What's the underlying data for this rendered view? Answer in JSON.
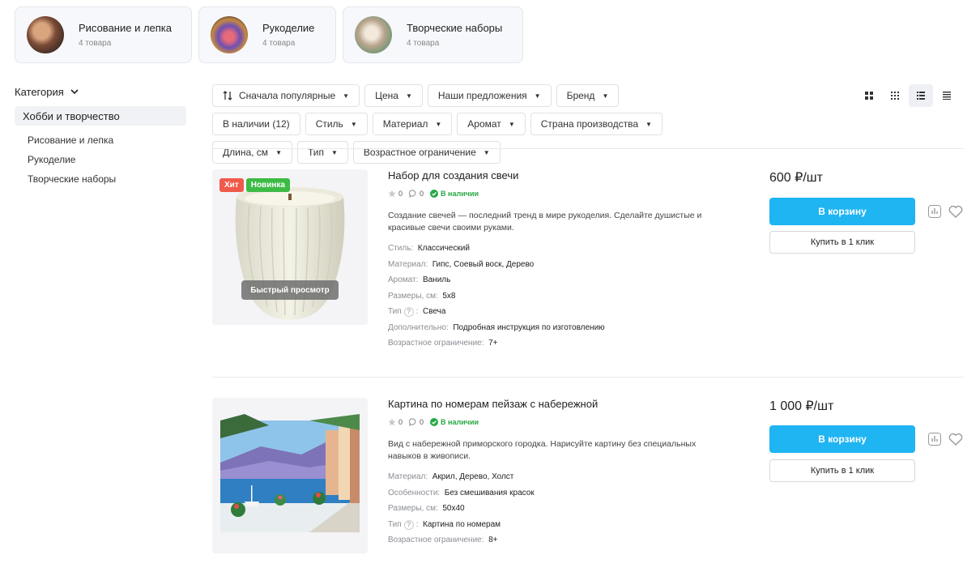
{
  "top_categories": [
    {
      "name": "Рисование и лепка",
      "count": "4 товара"
    },
    {
      "name": "Рукоделие",
      "count": "4 товара"
    },
    {
      "name": "Творческие наборы",
      "count": "4 товара"
    }
  ],
  "sidebar": {
    "heading": "Категория",
    "active": "Хобби и творчество",
    "items": [
      "Рисование и лепка",
      "Рукоделие",
      "Творческие наборы"
    ]
  },
  "filters": [
    "Сначала популярные",
    "Цена",
    "Наши предложения",
    "Бренд",
    "В наличии (12)",
    "Стиль",
    "Материал",
    "Аромат",
    "Страна производства",
    "Длина, см",
    "Тип",
    "Возрастное ограничение"
  ],
  "products": [
    {
      "title": "Набор для создания свечи",
      "rating": "0",
      "reviews": "0",
      "stock": "В наличии",
      "badges": [
        "Хит",
        "Новинка"
      ],
      "quick_view": "Быстрый просмотр",
      "description": "Создание свечей — последний тренд в мире рукоделия. Сделайте душистые и  красивые свечи своими руками.",
      "props": [
        {
          "k": "Стиль",
          "v": "Классический"
        },
        {
          "k": "Материал",
          "v": "Гипс, Соевый воск, Дерево"
        },
        {
          "k": "Аромат",
          "v": "Ваниль"
        },
        {
          "k": "Размеры, см",
          "v": "5x8"
        },
        {
          "k": "Тип",
          "v": "Свеча",
          "help": "?"
        },
        {
          "k": "Дополнительно",
          "v": "Подробная инструкция по изготовлению"
        },
        {
          "k": "Возрастное ограничение",
          "v": "7+"
        }
      ],
      "price": "600 ₽/шт",
      "cart_label": "В корзину",
      "one_click_label": "Купить в 1 клик"
    },
    {
      "title": "Картина по номерам пейзаж с набережной",
      "rating": "0",
      "reviews": "0",
      "stock": "В наличии",
      "description": "Вид с набережной приморского городка. Нарисуйте картину без специальных навыков в живописи.",
      "props": [
        {
          "k": "Материал",
          "v": "Акрил, Дерево, Холст"
        },
        {
          "k": "Особенности",
          "v": "Без смешивания красок"
        },
        {
          "k": "Размеры, см",
          "v": "50x40"
        },
        {
          "k": "Тип",
          "v": "Картина по номерам",
          "help": "?"
        },
        {
          "k": "Возрастное ограничение",
          "v": "8+"
        }
      ],
      "price": "1 000 ₽/шт",
      "cart_label": "В корзину",
      "one_click_label": "Купить в 1 клик"
    }
  ],
  "colors": {
    "accent": "#1fb4f2",
    "hit": "#f05a4a",
    "new": "#3dbb45",
    "instock": "#27a844"
  }
}
